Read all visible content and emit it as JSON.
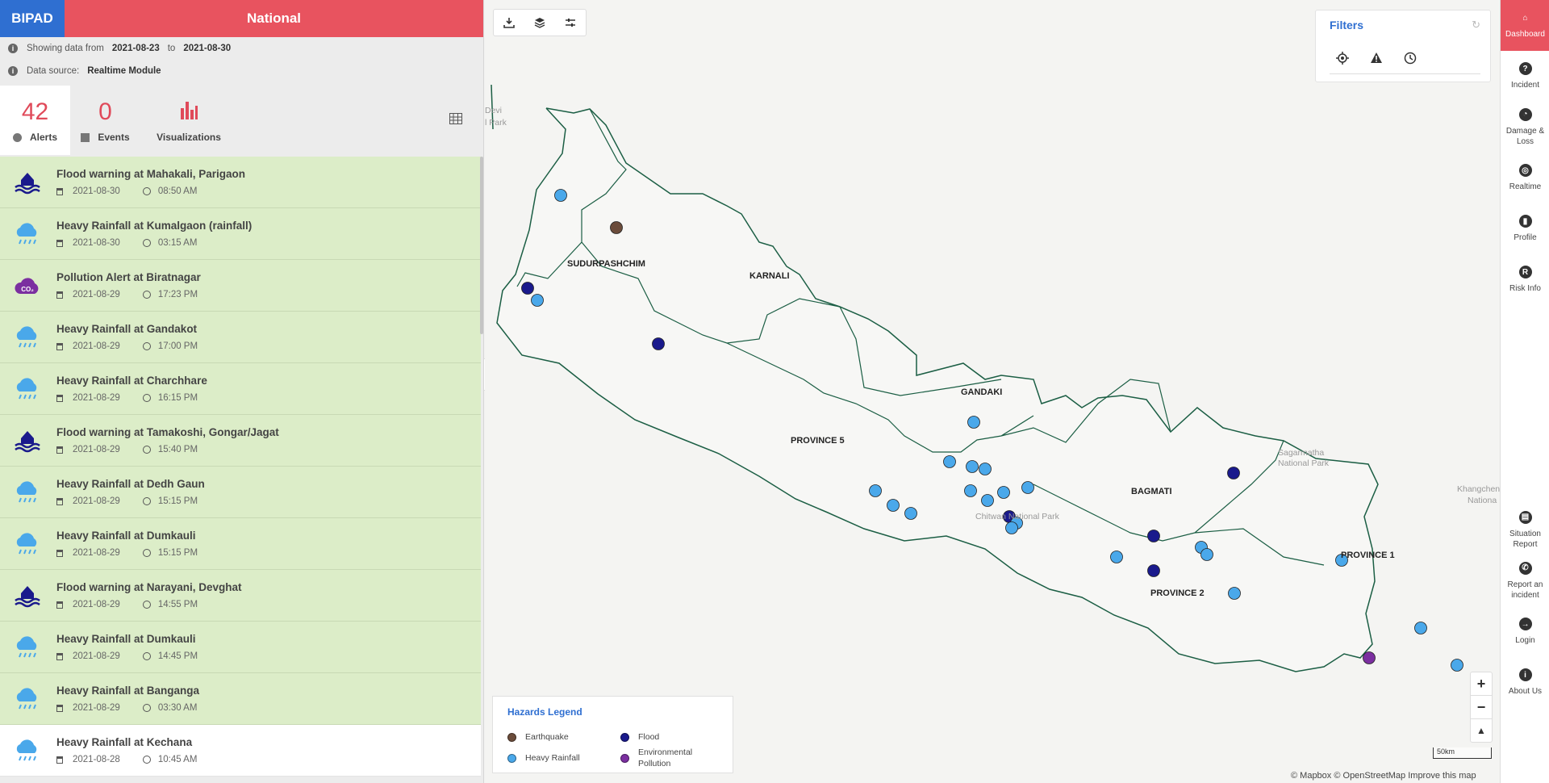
{
  "header": {
    "brand": "BIPAD",
    "region": "National"
  },
  "info": {
    "showing_label": "Showing data from",
    "from_date": "2021-08-23",
    "to_label": "to",
    "to_date": "2021-08-30",
    "source_label": "Data source:",
    "source_value": "Realtime Module"
  },
  "tabs": [
    {
      "count": "42",
      "label": "Alerts"
    },
    {
      "count": "0",
      "label": "Events"
    },
    {
      "label": "Visualizations"
    }
  ],
  "alerts": [
    {
      "title": "Flood warning at Mahakali, Parigaon",
      "date": "2021-08-30",
      "time": "08:50 AM",
      "icon": "flood-icon"
    },
    {
      "title": "Heavy Rainfall at Kumalgaon (rainfall)",
      "date": "2021-08-30",
      "time": "03:15 AM",
      "icon": "rain-icon"
    },
    {
      "title": "Pollution Alert at Biratnagar",
      "date": "2021-08-29",
      "time": "17:23 PM",
      "icon": "pollution-icon",
      "icon_text": "CO₂"
    },
    {
      "title": "Heavy Rainfall at Gandakot",
      "date": "2021-08-29",
      "time": "17:00 PM",
      "icon": "rain-icon"
    },
    {
      "title": "Heavy Rainfall at Charchhare",
      "date": "2021-08-29",
      "time": "16:15 PM",
      "icon": "rain-icon"
    },
    {
      "title": "Flood warning at Tamakoshi, Gongar/Jagat",
      "date": "2021-08-29",
      "time": "15:40 PM",
      "icon": "flood-icon"
    },
    {
      "title": "Heavy Rainfall at Dedh Gaun",
      "date": "2021-08-29",
      "time": "15:15 PM",
      "icon": "rain-icon"
    },
    {
      "title": "Heavy Rainfall at Dumkauli",
      "date": "2021-08-29",
      "time": "15:15 PM",
      "icon": "rain-icon"
    },
    {
      "title": "Flood warning at Narayani, Devghat",
      "date": "2021-08-29",
      "time": "14:55 PM",
      "icon": "flood-icon"
    },
    {
      "title": "Heavy Rainfall at Dumkauli",
      "date": "2021-08-29",
      "time": "14:45 PM",
      "icon": "rain-icon"
    },
    {
      "title": "Heavy Rainfall at Banganga",
      "date": "2021-08-29",
      "time": "03:30 AM",
      "icon": "rain-icon"
    },
    {
      "title": "Heavy Rainfall at Kechana",
      "date": "2021-08-28",
      "time": "10:45 AM",
      "icon": "rain-icon"
    }
  ],
  "map": {
    "province_labels": [
      "SUDURPASHCHIM",
      "KARNALI",
      "GANDAKI",
      "PROVINCE 5",
      "BAGMATI",
      "PROVINCE 2",
      "PROVINCE 1"
    ],
    "park_labels": [
      "Devi",
      "l Park",
      "Chitwan National Park",
      "Sagarmatha",
      "National Park",
      "Khangchen",
      "Nationa"
    ],
    "attribution": "© Mapbox © OpenStreetMap Improve this map",
    "scale": "50km"
  },
  "filters": {
    "title": "Filters"
  },
  "legend": {
    "title": "Hazards Legend",
    "items": [
      {
        "label": "Earthquake",
        "color": "#6b4c3b"
      },
      {
        "label": "Flood",
        "color": "#1a1a8c"
      },
      {
        "label": "Heavy Rainfall",
        "color": "#4aa8ea"
      },
      {
        "label": "Environmental Pollution",
        "color": "#7b2fa0"
      }
    ]
  },
  "colors": {
    "accent": "#e8535f",
    "brand": "#2f6fd1",
    "alert_bg": "#dcedc8"
  },
  "nav": [
    {
      "label": "Dashboard",
      "icon": "home-icon"
    },
    {
      "label": "Incident",
      "icon": "question-icon"
    },
    {
      "label": "Damage & Loss",
      "icon": "clock-icon"
    },
    {
      "label": "Realtime",
      "icon": "signal-icon"
    },
    {
      "label": "Profile",
      "icon": "bar-icon"
    },
    {
      "label": "Risk Info",
      "icon": "r-icon"
    },
    {
      "label": "Situation Report",
      "icon": "document-icon"
    },
    {
      "label": "Report an incident",
      "icon": "phone-icon"
    },
    {
      "label": "Login",
      "icon": "login-icon"
    },
    {
      "label": "About Us",
      "icon": "info-icon"
    }
  ]
}
